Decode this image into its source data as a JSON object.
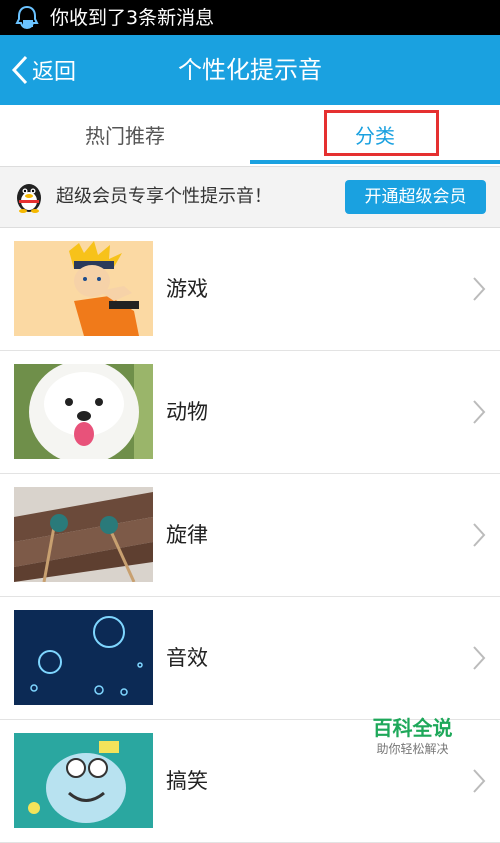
{
  "statusbar": {
    "message": "你收到了3条新消息"
  },
  "header": {
    "back_label": "返回",
    "title": "个性化提示音"
  },
  "tabs": [
    {
      "label": "热门推荐"
    },
    {
      "label": "分类",
      "selected": true
    }
  ],
  "banner": {
    "text": "超级会员专享个性提示音！",
    "button_label": "开通超级会员"
  },
  "categories": [
    {
      "label": "游戏",
      "image": "anime-character"
    },
    {
      "label": "动物",
      "image": "white-dog"
    },
    {
      "label": "旋律",
      "image": "xylophone"
    },
    {
      "label": "音效",
      "image": "water-bubbles"
    },
    {
      "label": "搞笑",
      "image": "cartoon"
    }
  ],
  "watermark": {
    "title": "百科全说",
    "subtitle": "助你轻松解决"
  },
  "colors": {
    "accent": "#1aa1e0",
    "highlight": "#e53030",
    "watermark": "#1ea85a"
  }
}
